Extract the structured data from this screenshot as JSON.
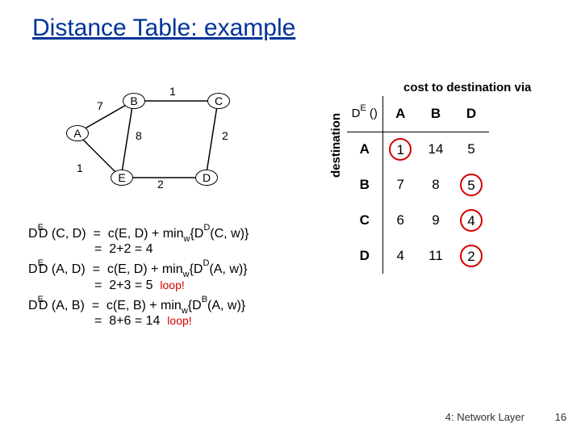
{
  "title": "Distance Table: example",
  "graph": {
    "nodes": [
      "A",
      "B",
      "C",
      "D",
      "E"
    ],
    "edges": [
      {
        "from": "A",
        "to": "B",
        "w": 7
      },
      {
        "from": "B",
        "to": "C",
        "w": 1
      },
      {
        "from": "A",
        "to": "E",
        "w": 1
      },
      {
        "from": "B",
        "to": "E",
        "w": 8
      },
      {
        "from": "C",
        "to": "D",
        "w": 2
      },
      {
        "from": "E",
        "to": "D",
        "w": 2
      }
    ]
  },
  "equations": {
    "eq1": {
      "lhs_sup": "E",
      "lhs_args": "D (C, D)",
      "r1a": "c(E, D) + min",
      "r1b": "{D",
      "r1c": "(C, w)}",
      "sub": "w",
      "sup": "D",
      "r2": "2+2  = 4"
    },
    "eq2": {
      "lhs_sup": "E",
      "lhs_args": "D (A, D)",
      "r1a": "c(E, D) + min",
      "r1b": "{D",
      "r1c": "(A, w)}",
      "sub": "w",
      "sup": "D",
      "r2": "2+3  = 5",
      "note": "loop!"
    },
    "eq3": {
      "lhs_sup": "E",
      "lhs_args": "D (A, B)",
      "r1a": "c(E, B) + min",
      "r1b": "{D",
      "r1c": "(A, w)}",
      "sub": "w",
      "sup": "B",
      "r2": "8+6  = 14",
      "note": "loop!"
    }
  },
  "table": {
    "caption": "cost to destination via",
    "corner": "D  ()",
    "corner_sup": "E",
    "col_heads": [
      "A",
      "B",
      "D"
    ],
    "row_heads": [
      "A",
      "B",
      "C",
      "D"
    ],
    "side_label": "destination",
    "cells": [
      [
        {
          "v": "1",
          "c": true
        },
        {
          "v": "14"
        },
        {
          "v": "5"
        }
      ],
      [
        {
          "v": "7"
        },
        {
          "v": "8"
        },
        {
          "v": "5",
          "c": true
        }
      ],
      [
        {
          "v": "6"
        },
        {
          "v": "9"
        },
        {
          "v": "4",
          "c": true
        }
      ],
      [
        {
          "v": "4"
        },
        {
          "v": "11"
        },
        {
          "v": "2",
          "c": true
        }
      ]
    ]
  },
  "footer": "4: Network Layer",
  "page": "16",
  "chart_data": {
    "type": "table",
    "title": "Distance table D^E() — cost to destination via neighbor",
    "row_labels": [
      "A",
      "B",
      "C",
      "D"
    ],
    "col_labels": [
      "A",
      "B",
      "D"
    ],
    "values": [
      [
        1,
        14,
        5
      ],
      [
        7,
        8,
        5
      ],
      [
        6,
        9,
        4
      ],
      [
        4,
        11,
        2
      ]
    ],
    "min_per_row": {
      "A": "A",
      "B": "D",
      "C": "D",
      "D": "D"
    },
    "graph_edges": [
      {
        "u": "A",
        "v": "B",
        "w": 7
      },
      {
        "u": "B",
        "v": "C",
        "w": 1
      },
      {
        "u": "A",
        "v": "E",
        "w": 1
      },
      {
        "u": "B",
        "v": "E",
        "w": 8
      },
      {
        "u": "C",
        "v": "D",
        "w": 2
      },
      {
        "u": "E",
        "v": "D",
        "w": 2
      }
    ]
  }
}
